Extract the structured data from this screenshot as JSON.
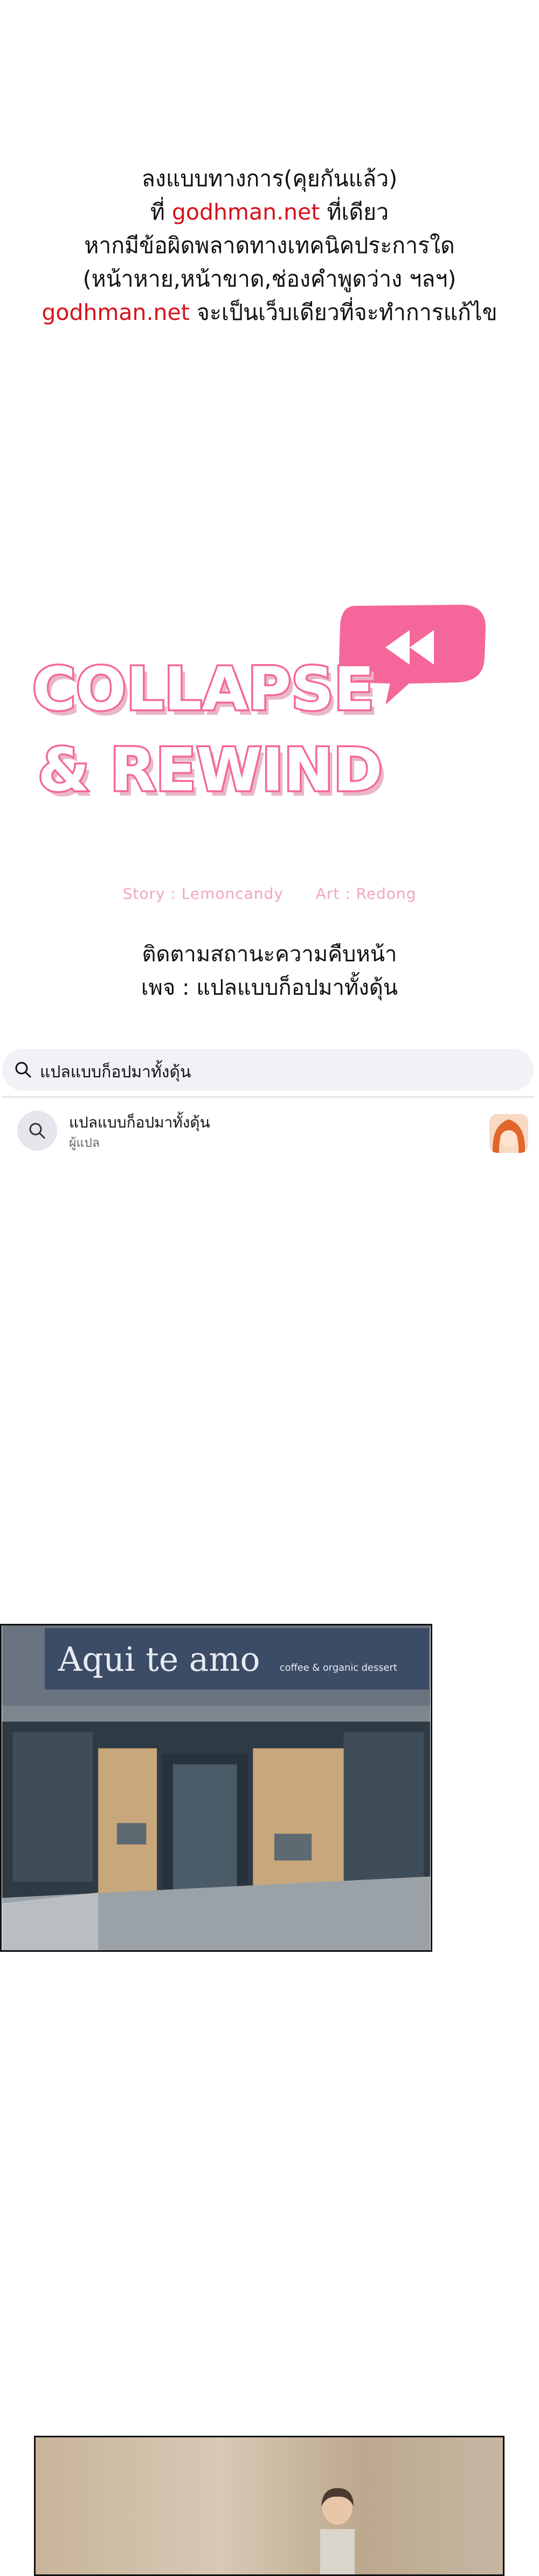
{
  "notice": {
    "line1": "ลงแบบทางการ(คุยกันแล้ว)",
    "line2_prefix": "ที่ ",
    "line2_link": "godhman.net",
    "line2_suffix": " ที่เดียว",
    "line3": "หากมีข้อผิดพลาดทางเทคนิคประการใด",
    "line4": "(หน้าหาย,หน้าขาด,ช่องคำพูดว่าง ฯลฯ)",
    "line5_link": "godhman.net",
    "line5_suffix": " จะเป็นเว็บเดียวที่จะทำการแก้ไข",
    "link_color": "#d6101a"
  },
  "logo": {
    "line1": "COLLAPSE",
    "line2": "& REWIND",
    "accent_color": "#f5679a",
    "fill_color": "#ffffff",
    "shadow_color": "#e8b8c4"
  },
  "credits": {
    "story": "Story : Lemoncandy",
    "art": "Art : Redong"
  },
  "follow": {
    "line1": "ติดตามสถานะความคืบหน้า",
    "line2": "เพจ : แปลแบบก็อปมาทั้งดุ้น"
  },
  "search": {
    "query": "แปลแบบก็อปมาทั้งดุ้น",
    "icon": "search-icon"
  },
  "result": {
    "name": "แปลแบบก็อปมาทั้งดุ้น",
    "subtitle": "ผู้แปล",
    "icon": "search-icon",
    "avatar": "page-avatar"
  },
  "panel1": {
    "sign_main": "Aqui te amo",
    "sign_sub": "coffee & organic dessert"
  }
}
